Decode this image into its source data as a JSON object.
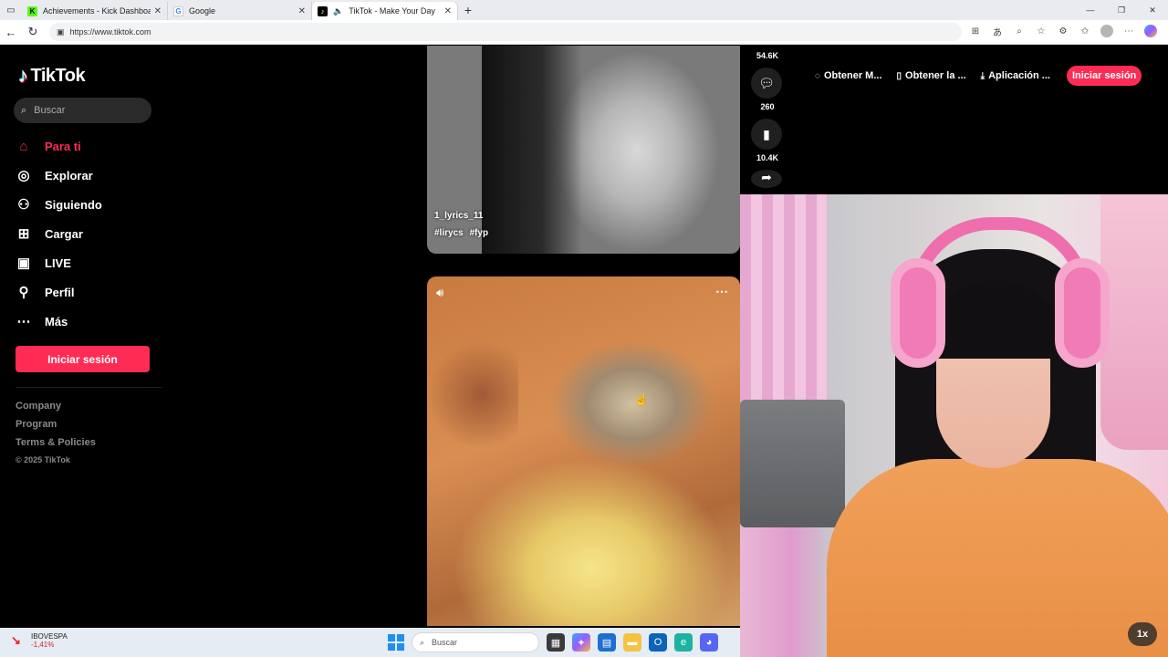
{
  "browser": {
    "tabs": [
      {
        "title": "Achievements - Kick Dashboard",
        "favicon": "K",
        "favicon_color": "#53fc18"
      },
      {
        "title": "Google",
        "favicon": "G",
        "favicon_color": "#4285f4"
      },
      {
        "title": "TikTok - Make Your Day",
        "favicon": "♪",
        "favicon_color": "#000000",
        "active": true
      }
    ],
    "new_tab": "+",
    "url": "https://www.tiktok.com"
  },
  "sidebar": {
    "logo": "TikTok",
    "search_placeholder": "Buscar",
    "nav": [
      {
        "label": "Para ti",
        "icon": "home-icon",
        "active": true
      },
      {
        "label": "Explorar",
        "icon": "compass-icon"
      },
      {
        "label": "Siguiendo",
        "icon": "following-icon"
      },
      {
        "label": "Cargar",
        "icon": "upload-icon"
      },
      {
        "label": "LIVE",
        "icon": "live-icon"
      },
      {
        "label": "Perfil",
        "icon": "profile-icon"
      },
      {
        "label": "Más",
        "icon": "more-icon"
      }
    ],
    "login_label": "Iniciar sesión",
    "footer": {
      "links": [
        "Company",
        "Program",
        "Terms & Policies"
      ],
      "copyright": "© 2025 TikTok"
    }
  },
  "feed": {
    "video1": {
      "caption": "1_lyrics_11",
      "tags": [
        "#lirycs",
        "#fyp"
      ]
    },
    "actions": [
      {
        "icon": "like-icon",
        "count": "54.6K"
      },
      {
        "icon": "comment-icon",
        "count": "260"
      },
      {
        "icon": "bookmark-icon",
        "count": "10.4K"
      },
      {
        "icon": "share-icon",
        "count": ""
      }
    ]
  },
  "top_actions": {
    "items": [
      {
        "label": "Obtener M...",
        "icon": "coin-icon"
      },
      {
        "label": "Obtener la ...",
        "icon": "phone-icon"
      },
      {
        "label": "Aplicación ...",
        "icon": "download-icon"
      }
    ],
    "login_label": "Iniciar sesión"
  },
  "webcam": {
    "speed": "1x"
  },
  "taskbar": {
    "ticker_name": "IBOVESPA",
    "ticker_change": "-1,41%",
    "search_placeholder": "Buscar"
  },
  "colors": {
    "accent": "#fe2c55"
  }
}
